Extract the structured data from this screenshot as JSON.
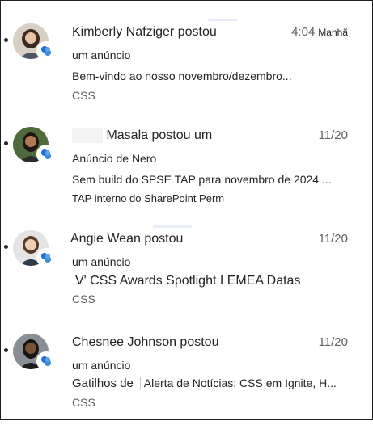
{
  "feed": [
    {
      "line1": "Kimberly Nafziger postou",
      "time": "4:04",
      "time_suffix": "Manhã",
      "line2": "um anúncio",
      "line3": "Bem-vindo ao nosso novembro/dezembro...",
      "line4": "CSS",
      "avatar_icon": "person-avatar",
      "app_icon": "viva-connections-icon"
    },
    {
      "line1": "Masala postou um",
      "time": "11/20",
      "line2": "Anúncio de Nero",
      "line3": "Sem build do SPSE TAP para novembro de 2024 ...",
      "line4": "TAP interno do SharePoint Perm",
      "avatar_icon": "person-avatar",
      "app_icon": "viva-connections-icon"
    },
    {
      "line1": "Angie Wean postou",
      "time": "11/20",
      "line2": "um anúncio",
      "line3": "V' CSS Awards Spotlight I EMEA Datas",
      "line4": "CSS",
      "avatar_icon": "person-avatar",
      "app_icon": "viva-connections-icon"
    },
    {
      "line1": "Chesnee Johnson postou",
      "time": "11/20",
      "line2": "um anúncio",
      "line3a": "Gatilhos de",
      "line3b": "Alerta de Notícias: CSS em Ignite, H...",
      "line4": "CSS",
      "avatar_icon": "person-avatar",
      "app_icon": "viva-connections-icon"
    }
  ],
  "colors": {
    "text_primary": "#242424",
    "text_secondary": "#616161",
    "app_icon_blue": "#1f6fd6"
  }
}
